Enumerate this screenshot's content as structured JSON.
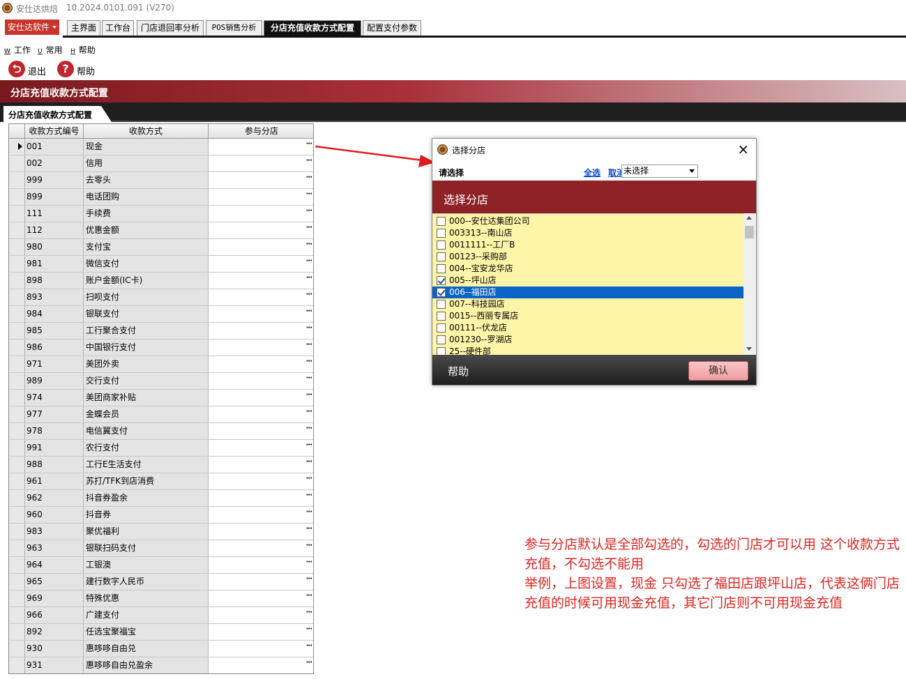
{
  "window": {
    "app_name": "安仕达烘焙",
    "version": "10.2024.0101.091 (V270)"
  },
  "brand_menu": {
    "label": "安仕达软件"
  },
  "tabs": [
    {
      "label": "主界面"
    },
    {
      "label": "工作台"
    },
    {
      "label": "门店退回率分析"
    },
    {
      "label": "POS销售分析"
    },
    {
      "label": "分店充值收款方式配置",
      "active": true
    },
    {
      "label": "配置支付参数"
    }
  ],
  "menubar": [
    {
      "key": "W",
      "label": "工作"
    },
    {
      "key": "U",
      "label": "常用"
    },
    {
      "key": "H",
      "label": "帮助"
    }
  ],
  "toolbar": {
    "exit_label": "退出",
    "help_label": "帮助"
  },
  "banner": {
    "title": "分店充值收款方式配置"
  },
  "subtab": {
    "label": "分店充值收款方式配置"
  },
  "grid": {
    "columns": [
      "收款方式编号",
      "收款方式",
      "参与分店"
    ],
    "rows": [
      {
        "code": "001",
        "name": "现金",
        "current": true
      },
      {
        "code": "002",
        "name": "信用"
      },
      {
        "code": "999",
        "name": "去零头"
      },
      {
        "code": "899",
        "name": "电话团购"
      },
      {
        "code": "111",
        "name": "手续费"
      },
      {
        "code": "112",
        "name": "优惠金额"
      },
      {
        "code": "980",
        "name": "支付宝"
      },
      {
        "code": "981",
        "name": "微信支付"
      },
      {
        "code": "898",
        "name": "账户金额(IC卡)"
      },
      {
        "code": "893",
        "name": "扫呗支付"
      },
      {
        "code": "984",
        "name": "银联支付"
      },
      {
        "code": "985",
        "name": "工行聚合支付"
      },
      {
        "code": "986",
        "name": "中国银行支付"
      },
      {
        "code": "971",
        "name": "美团外卖"
      },
      {
        "code": "989",
        "name": "交行支付"
      },
      {
        "code": "974",
        "name": "美团商家补贴"
      },
      {
        "code": "977",
        "name": "金蝶会员"
      },
      {
        "code": "978",
        "name": "电信翼支付"
      },
      {
        "code": "991",
        "name": "农行支付"
      },
      {
        "code": "988",
        "name": "工行E生活支付"
      },
      {
        "code": "961",
        "name": "苏打/TFK到店消费"
      },
      {
        "code": "962",
        "name": "抖音券盈余"
      },
      {
        "code": "960",
        "name": "抖音券"
      },
      {
        "code": "983",
        "name": "聚优福利"
      },
      {
        "code": "963",
        "name": "银联扫码支付"
      },
      {
        "code": "964",
        "name": "工银澳"
      },
      {
        "code": "965",
        "name": "建行数字人民币"
      },
      {
        "code": "969",
        "name": "特殊优惠"
      },
      {
        "code": "966",
        "name": "广建支付"
      },
      {
        "code": "892",
        "name": "任选宝聚福宝"
      },
      {
        "code": "930",
        "name": "惠哆哆自由兑"
      },
      {
        "code": "931",
        "name": "惠哆哆自由兑盈余"
      }
    ],
    "ellipsis": "···"
  },
  "dialog": {
    "title": "选择分店",
    "prompt": "请选择",
    "select_all": "全选",
    "cancel": "取消",
    "filter_value": "未选择",
    "header": "选择分店",
    "stores": [
      {
        "name": "000--安仕达集团公司",
        "checked": false
      },
      {
        "name": "003313--南山店",
        "checked": false
      },
      {
        "name": "0011111--工厂B",
        "checked": false
      },
      {
        "name": "00123--采购部",
        "checked": false
      },
      {
        "name": "004--宝安龙华店",
        "checked": false
      },
      {
        "name": "005--坪山店",
        "checked": true
      },
      {
        "name": "006--福田店",
        "checked": true,
        "highlighted": true
      },
      {
        "name": "007--科技园店",
        "checked": false
      },
      {
        "name": "0015--西丽专属店",
        "checked": false
      },
      {
        "name": "00111--伏龙店",
        "checked": false
      },
      {
        "name": "001230--罗湖店",
        "checked": false
      },
      {
        "name": "25--硬件部",
        "checked": false
      }
    ],
    "help": "帮助",
    "ok": "确认"
  },
  "annotation": {
    "lines": [
      "参与分店默认是全部勾选的，勾选的门店才可以用 这个收款方式充值，不勾选不能用",
      "举例，上图设置，现金 只勾选了福田店跟坪山店，代表这俩门店充值的时候可用现金充值，其它门店则不可用现金充值"
    ],
    "color": "#e0241f"
  },
  "colors": {
    "brand": "#c9342b",
    "banner": "#8e2226",
    "highlight": "#0a63c6",
    "list_bg": "#fff5a8"
  }
}
